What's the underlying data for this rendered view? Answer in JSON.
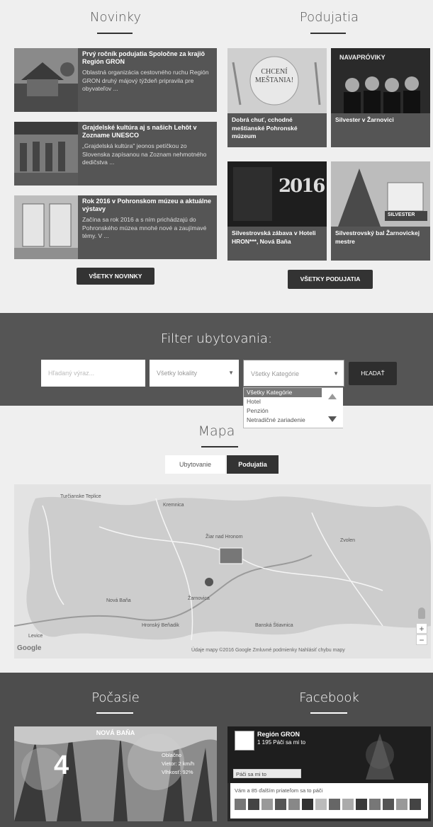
{
  "sections": {
    "news_title": "Novinky",
    "events_title": "Podujatia",
    "filter_title": "Filter ubytovania:",
    "map_title": "Mapa",
    "weather_title": "Počasie",
    "facebook_title": "Facebook"
  },
  "news": [
    {
      "title": "Prvý ročník podujatia Spoločne za krajiö Región GRON",
      "text": "Oblastná organizácia cestovného ruchu Región GRON druhý májový týždeň pripravila pre obyvateľov ..."
    },
    {
      "title": "Grajdelské kultúra aj s našich Lehôt v Zozname UNESCO",
      "text": "„Grajdelská kultúra\" jeonos petíčkou zo Slovenska zapísanou na Zoznam nehmotného dedičstva ..."
    },
    {
      "title": "Rok 2016 v Pohronskom múzeu a aktuálne výstavy",
      "text": "Začína sa rok 2016 a s ním prichádzajú do Pohronského múzea mnohé nové a zaujímavé témy. V ..."
    }
  ],
  "news_button": "VŠETKY NOVINKY",
  "events": [
    {
      "title": "Dobrá chuť, cchodné meštianské Pohronské múzeum",
      "img_text": "CHCENÍ MEŠTANIA!"
    },
    {
      "title": "Silvester v Žarnovici",
      "img_text": "NAVAPRÓVIKY"
    },
    {
      "title": "Silvestrovská zábava v Hoteli HRON***, Nová Baňa",
      "img_text": "2016"
    },
    {
      "title": "Silvestrovský bal Žarnovickej mestre",
      "img_text": "SILVESTER"
    }
  ],
  "events_button": "VŠETKY PODUJATIA",
  "filter": {
    "search_placeholder": "Hľadaný výraz...",
    "location_value": "Všetky lokality",
    "category_value": "Všetky Kategórie",
    "search_button": "HĽADAŤ",
    "category_options": [
      "Všetky Kategórie",
      "Hotel",
      "Penzión",
      "Netradičné zariadenie"
    ]
  },
  "map": {
    "tab_accommodation": "Ubytovanie",
    "tab_events": "Podujatia",
    "attribution": "Údaje mapy ©2016 Google   Zmluvné podmienky   Nahlásiť chybu mapy",
    "google": "Google",
    "zoom_in": "+",
    "zoom_out": "−",
    "place_labels": [
      "Turčianske Teplice",
      "Kremnica",
      "Žiar nad Hronom",
      "Nová Baňa",
      "Žarnovica",
      "Banská Štiavnica",
      "Levice",
      "Hronský Beňadik",
      "Zvolen"
    ]
  },
  "weather": {
    "city": "NOVÁ BAŇA",
    "temp": "4",
    "lines": [
      "Oblačno",
      "Vietor: 2 km/h",
      "Vlhkosť: 92%"
    ]
  },
  "facebook": {
    "page_name": "Región GRON",
    "likes": "1 195 Páči sa mi to",
    "like_button": "Páči sa mi to",
    "friends_text": "Vám a 85 ďalším priateľom sa to páči"
  },
  "colors": {
    "band": "#555555",
    "dark_button": "#333333",
    "page_bg": "#efefef",
    "map_land": "#cdcdcd"
  }
}
